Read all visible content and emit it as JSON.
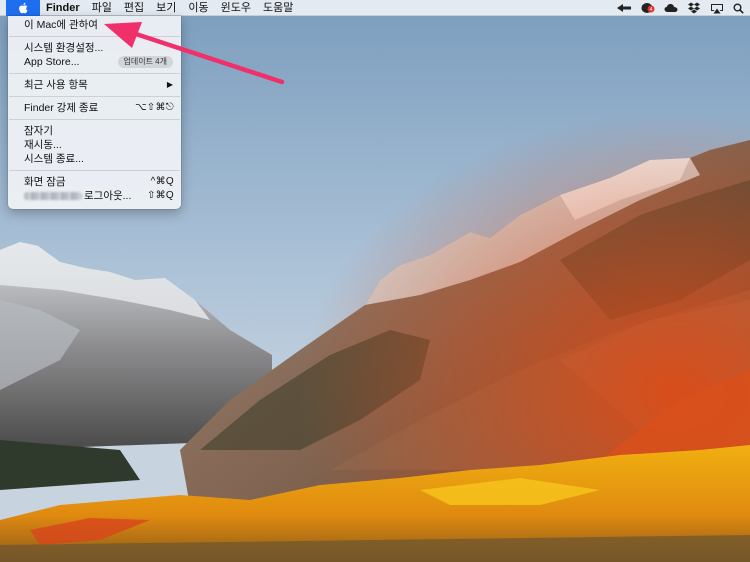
{
  "menubar": {
    "app_name": "Finder",
    "menus": [
      "파일",
      "편집",
      "보기",
      "이동",
      "윈도우",
      "도움말"
    ],
    "status_icons": [
      "back-arrow-icon",
      "notification-badge-icon",
      "cloud-icon",
      "dropbox-icon",
      "airplay-icon",
      "spotlight-icon"
    ]
  },
  "apple_menu": {
    "about": "이 Mac에 관하여",
    "system_prefs": "시스템 환경설정...",
    "app_store": "App Store...",
    "app_store_badge": "업데이트 4개",
    "recent_items": "최근 사용 항목",
    "force_quit": "Finder 강제 종료",
    "force_quit_shortcut": "⌥⇧⌘⎋",
    "sleep": "잠자기",
    "restart": "재시동...",
    "shutdown": "시스템 종료...",
    "lock_screen": "화면 잠금",
    "lock_screen_shortcut": "^⌘Q",
    "logout_suffix": "로그아웃...",
    "logout_shortcut": "⇧⌘Q"
  },
  "colors": {
    "accent_blue": "#1e6ff0",
    "annotation_arrow": "#f0306a"
  }
}
